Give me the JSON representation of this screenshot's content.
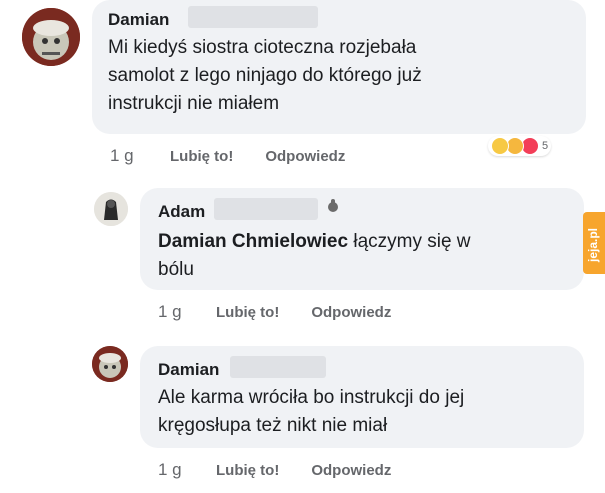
{
  "comments": [
    {
      "author": "Damian",
      "text": "Mi kiedyś siostra cioteczna rozjebała samolot z lego ninjago do którego już instrukcji nie miałem",
      "lines": [
        "Mi kiedyś siostra cioteczna rozjebała",
        "samolot z lego ninjago do którego już",
        "instrukcji nie miałem"
      ],
      "time": "1 g",
      "like_label": "Lubię to!",
      "reply_label": "Odpowiedz",
      "reaction_count": "5"
    },
    {
      "author": "Adam",
      "mention": "Damian Chmielowiec",
      "lines_after_mention": [
        "łączymy się w",
        "bólu"
      ],
      "time": "1 g",
      "like_label": "Lubię to!",
      "reply_label": "Odpowiedz"
    },
    {
      "author": "Damian",
      "lines": [
        "Ale karma wróciła bo instrukcji do jej",
        "kręgosłupa też nikt nie miał"
      ],
      "time": "1 g",
      "like_label": "Lubię to!",
      "reply_label": "Odpowiedz"
    }
  ],
  "watermark": "jeja.pl",
  "colors": {
    "bubble": "#f0f2f5",
    "secondary_text": "#65676b",
    "watermark": "#f7a52d"
  }
}
